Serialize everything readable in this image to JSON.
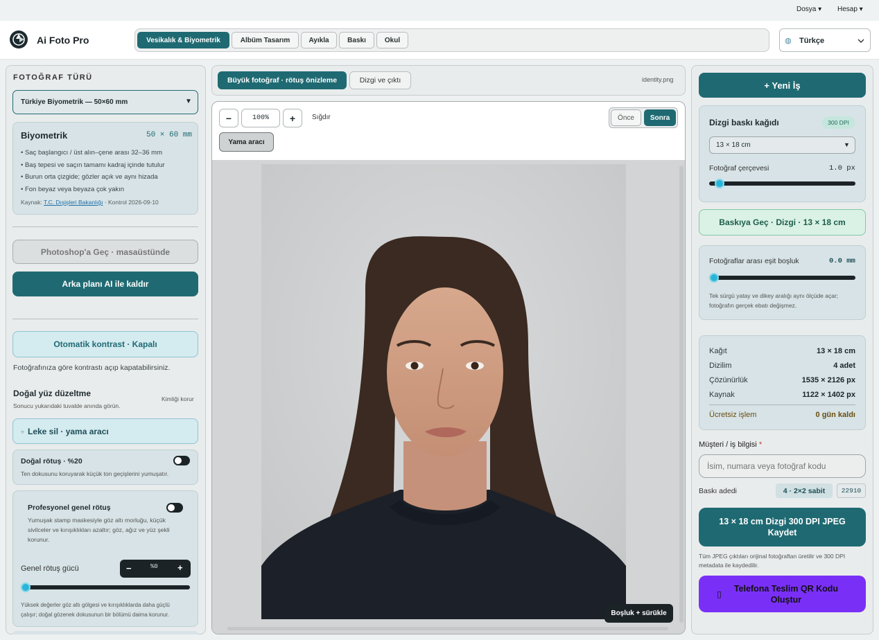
{
  "topmenu": {
    "file": "Dosya ▾",
    "account": "Hesap ▾"
  },
  "brand": {
    "name": "Ai Foto Pro"
  },
  "nav": {
    "tabs": [
      "Vesikalık & Biyometrik",
      "Albüm Tasarım",
      "Ayıkla",
      "Baskı",
      "Okul"
    ],
    "active_index": 0
  },
  "language": {
    "value": "Türkçe",
    "icon": "globe-icon"
  },
  "left": {
    "section_title": "FOTOĞRAF TÜRÜ",
    "photo_type": "Türkiye Biyometrik — 50×60 mm",
    "bio": {
      "title": "Biyometrik",
      "size": "50 × 60 mm",
      "rules": [
        "Saç başlangıcı / üst alın–çene arası 32–36 mm",
        "Baş tepesi ve saçın tamamı kadraj içinde tutulur",
        "Burun orta çizgide; gözler açık ve aynı hizada",
        "Fon beyaz veya beyaza çok yakın"
      ],
      "source_prefix": "Kaynak:",
      "source_link": "T.C. Dışişleri Bakanlığı",
      "source_suffix": "· Kontrol 2026-09-10"
    },
    "photoshop_btn": "Photoshop'a Geç · masaüstünde",
    "remove_bg_btn": "Arka planı AI ile kaldır",
    "auto_contrast_btn": "Otomatik kontrast · Kapalı",
    "auto_contrast_note": "Fotoğrafınıza göre kontrastı açıp kapatabilirsiniz.",
    "natural_face_title": "Doğal yüz düzeltme",
    "natural_face_sub": "Sonucu yukarıdaki tuvalde anında görün.",
    "keep_identity": "Kimliği korur",
    "spot_btn": "Leke sil · yama aracı",
    "natural_retouch": {
      "label": "Doğal rötuş · %20",
      "desc": "Ten dokusunu koruyarak küçük ton geçişlerini yumuşatır."
    },
    "pro_retouch": {
      "label": "Profesyonel genel rötuş",
      "desc": "Yumuşak stamp maskesiyle göz altı morluğu, küçük sivilceler ve kırışıklıkları azaltır; göz, ağız ve yüz şekli korunur.",
      "strength_label": "Genel rötuş gücü",
      "stepper_value": "%0",
      "minus": "−",
      "plus": "+",
      "strength": 0,
      "footnote": "Yüksek değerler göz altı gölgesi ve kırışıklıklarda daha güçlü çalışır; doğal gözenek dokusunun bir bölümü daima korunur."
    }
  },
  "center": {
    "tabs": [
      "Büyük fotoğraf · rötuş önizleme",
      "Dizgi ve çıktı"
    ],
    "filename": "identity.png",
    "zoom_minus": "−",
    "zoom_value": "100%",
    "zoom_plus": "+",
    "fit": "Sığdır",
    "before": "Önce",
    "after": "Sonra",
    "patch_tool": "Yama aracı",
    "hint": "Boşluk + sürükle"
  },
  "right": {
    "new_job": "+ Yeni İş",
    "paper": {
      "title": "Dizgi baskı kağıdı",
      "dpi_badge": "300 DPI",
      "size": "13 × 18 cm",
      "frame_label": "Fotoğraf çerçevesi",
      "frame_value": "1.0 px",
      "frame_level": 0.04
    },
    "print_btn": "Baskıya Geç · Dizgi · 13 × 18 cm",
    "gap": {
      "label": "Fotoğraflar arası eşit boşluk",
      "value": "0.0 mm",
      "level": 0,
      "note": "Tek sürgü yatay ve dikey aralığı aynı ölçüde açar; fotoğrafın gerçek ebatı değişmez."
    },
    "summary": [
      {
        "label": "Kağıt",
        "value": "13 × 18 cm"
      },
      {
        "label": "Dizilim",
        "value": "4 adet"
      },
      {
        "label": "Çözünürlük",
        "value": "1535 × 2126 px"
      },
      {
        "label": "Kaynak",
        "value": "1122 × 1402 px"
      }
    ],
    "free_label": "Ücretsiz işlem",
    "free_value": "0 gün kaldı",
    "customer_label": "Müşteri / iş bilgisi",
    "customer_placeholder": "İsim, numara veya fotoğraf kodu",
    "copies_label": "Baskı adedi",
    "copies_badge": "4 · 2×2 sabit",
    "copies_code": "22910",
    "save_btn": "13 × 18 cm Dizgi 300 DPI JPEG Kaydet",
    "save_note": "Tüm JPEG çıktıları orijinal fotoğraftan üretilir ve 300 DPI metadata ile kaydedilir.",
    "qr_btn": "Telefona Teslim QR Kodu Oluştur"
  },
  "colors": {
    "accent": "#1f6a72",
    "purple": "#7a2ff7",
    "slider": "#2ab5d8"
  }
}
